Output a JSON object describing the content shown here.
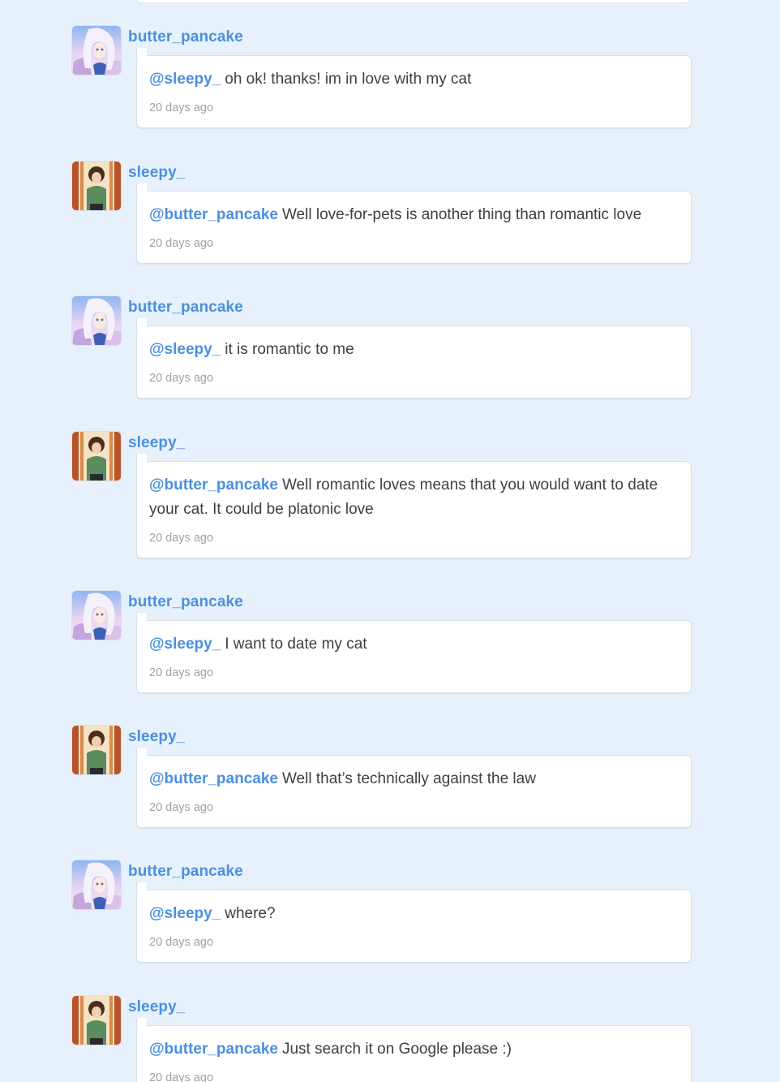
{
  "colors": {
    "background": "#e7f1fb",
    "card": "#ffffff",
    "username": "#4a90e0",
    "body_text": "#3b4045",
    "timestamp": "#9aa3ab"
  },
  "comments": [
    {
      "author": "butter_pancake",
      "avatar_icon": "anime-girl-avatar-icon",
      "mention": "@sleepy_",
      "text": "oh ok! thanks! im in love with my cat",
      "time": "20 days ago"
    },
    {
      "author": "sleepy_",
      "avatar_icon": "boy-portrait-avatar-icon",
      "mention": "@butter_pancake",
      "text": "Well love-for-pets is another thing than romantic love",
      "time": "20 days ago"
    },
    {
      "author": "butter_pancake",
      "avatar_icon": "anime-girl-avatar-icon",
      "mention": "@sleepy_",
      "text": "it is romantic to me",
      "time": "20 days ago"
    },
    {
      "author": "sleepy_",
      "avatar_icon": "boy-portrait-avatar-icon",
      "mention": "@butter_pancake",
      "text": "Well romantic loves means that you would want to date your cat. It could be platonic love",
      "time": "20 days ago"
    },
    {
      "author": "butter_pancake",
      "avatar_icon": "anime-girl-avatar-icon",
      "mention": "@sleepy_",
      "text": "I want to date my cat",
      "time": "20 days ago"
    },
    {
      "author": "sleepy_",
      "avatar_icon": "boy-portrait-avatar-icon",
      "mention": "@butter_pancake",
      "text": "Well that’s technically against the law",
      "time": "20 days ago"
    },
    {
      "author": "butter_pancake",
      "avatar_icon": "anime-girl-avatar-icon",
      "mention": "@sleepy_",
      "text": "where?",
      "time": "20 days ago"
    },
    {
      "author": "sleepy_",
      "avatar_icon": "boy-portrait-avatar-icon",
      "mention": "@butter_pancake",
      "text": "Just search it on Google please :)",
      "time": "20 days ago"
    }
  ]
}
